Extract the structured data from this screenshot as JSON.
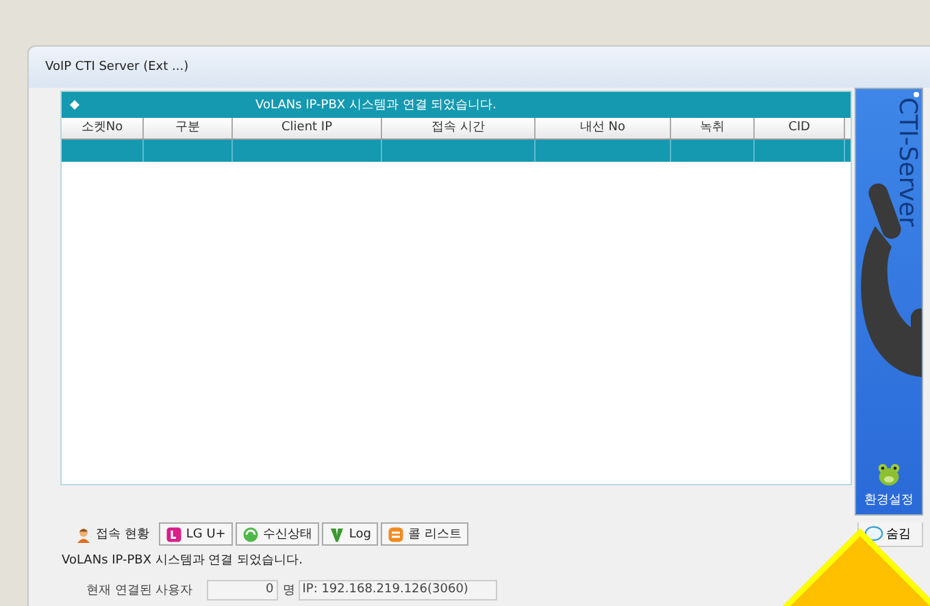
{
  "window": {
    "title": "VoIP CTI Server (Ext ...)"
  },
  "table": {
    "banner": "VoLANs IP-PBX 시스템과 연결 되었습니다.",
    "columns": [
      "소켓No",
      "구분",
      "Client IP",
      "접속 시간",
      "내선 No",
      "녹취",
      "CID"
    ],
    "rows": [
      {
        "selected": true,
        "cells": [
          "",
          "",
          "",
          "",
          "",
          "",
          ""
        ]
      }
    ]
  },
  "side_panel": {
    "logo": "CTI-Server",
    "settings_label": "환경설정"
  },
  "hide_button": {
    "label": "숨김"
  },
  "tabs": [
    {
      "label": "접속 현황",
      "selected": true
    },
    {
      "label": "LG U+",
      "selected": false
    },
    {
      "label": "수신상태",
      "selected": false
    },
    {
      "label": "Log",
      "selected": false
    },
    {
      "label": "콜 리스트",
      "selected": false
    }
  ],
  "status_message": "VoLANs IP-PBX 시스템과 연결 되었습니다.",
  "footer": {
    "users_label": "현재 연결된 사용자",
    "users_count": "0",
    "users_unit": "명",
    "ip": "IP: 192.168.219.126(3060)"
  }
}
